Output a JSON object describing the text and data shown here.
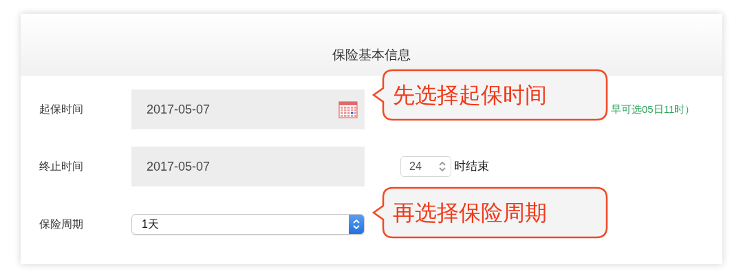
{
  "header": {
    "title": "保险基本信息"
  },
  "rows": [
    {
      "kind": "date",
      "label": "起保时间",
      "value": "2017-05-07",
      "calendar": true,
      "hint": "早可选05日11时）"
    },
    {
      "kind": "date",
      "label": "终止时间",
      "value": "2017-05-07",
      "calendar": false,
      "hour": "24",
      "hour_suffix": "时结束"
    },
    {
      "kind": "select",
      "label": "保险周期",
      "value": "1天"
    }
  ],
  "callouts": [
    {
      "text": "先选择起保时间"
    },
    {
      "text": "再选择保险周期"
    }
  ]
}
